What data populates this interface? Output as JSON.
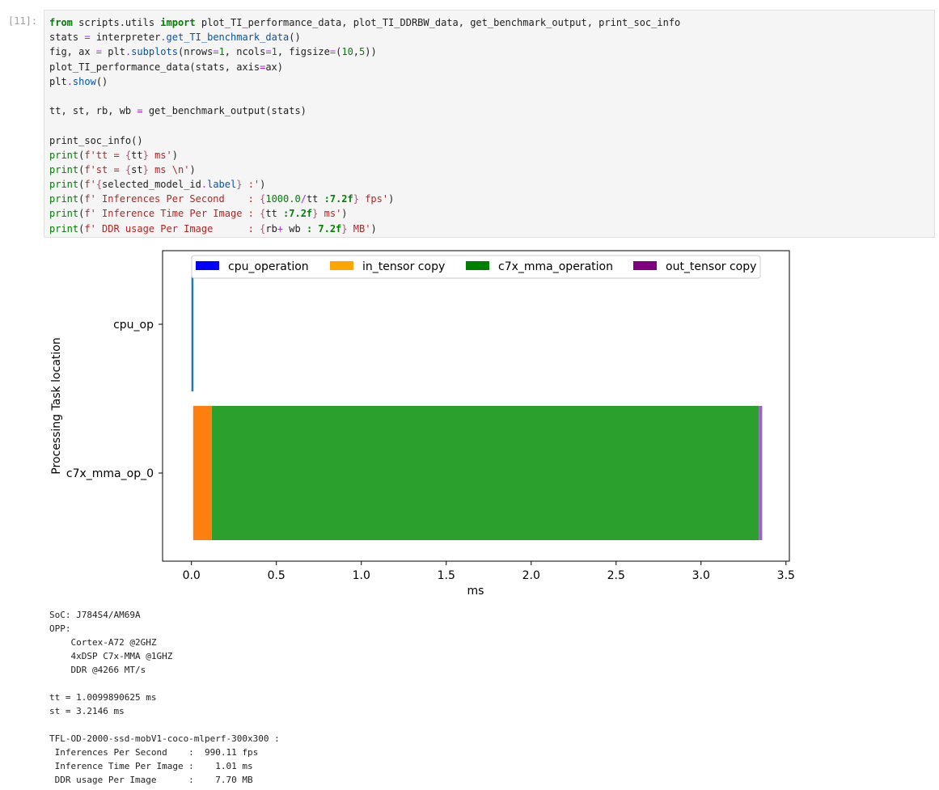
{
  "cell": {
    "prompt": "[11]:"
  },
  "chart_data": {
    "type": "bar",
    "orientation": "horizontal-stacked-timeline",
    "categories": [
      "cpu_op",
      "c7x_mma_op_0"
    ],
    "series": [
      {
        "name": "cpu_operation",
        "color": "#0000ff",
        "values": [
          [
            0.0,
            0.01
          ],
          null
        ]
      },
      {
        "name": "in_tensor copy",
        "color": "#ffa500",
        "values": [
          null,
          [
            0.01,
            0.12
          ]
        ]
      },
      {
        "name": "c7x_mma_operation",
        "color": "#008000",
        "values": [
          null,
          [
            0.12,
            3.34
          ]
        ]
      },
      {
        "name": "out_tensor copy",
        "color": "#800080",
        "values": [
          null,
          [
            3.34,
            3.36
          ]
        ]
      }
    ],
    "xlabel": "ms",
    "ylabel": "Processing Task location",
    "xticks": [
      "0.0",
      "0.5",
      "1.0",
      "1.5",
      "2.0",
      "2.5",
      "3.0",
      "3.5"
    ],
    "xlim": [
      -0.17,
      3.52
    ],
    "legend": "top-center",
    "grid": false
  },
  "output": {
    "lines": [
      "SoC: J784S4/AM69A",
      "OPP:",
      "    Cortex-A72 @2GHZ",
      "    4xDSP C7x-MMA @1GHZ",
      "    DDR @4266 MT/s",
      "",
      "tt = 1.0099890625 ms",
      "st = 3.2146 ms",
      "",
      "TFL-OD-2000-ssd-mobV1-coco-mlperf-300x300 :",
      " Inferences Per Second    :  990.11 fps",
      " Inference Time Per Image :    1.01 ms",
      " DDR usage Per Image      :    7.70 MB"
    ]
  }
}
